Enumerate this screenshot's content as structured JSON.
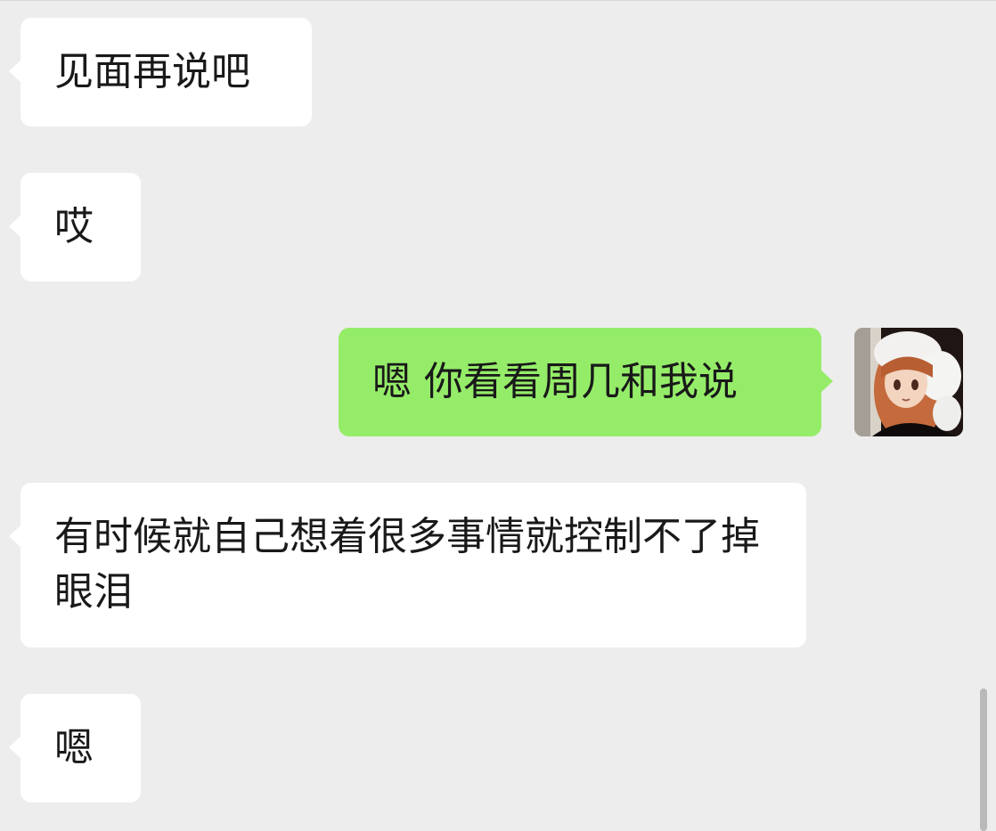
{
  "chat": {
    "messages": [
      {
        "side": "left",
        "text": "见面再说吧"
      },
      {
        "side": "left",
        "text": "哎"
      },
      {
        "side": "right",
        "text": "嗯 你看看周几和我说"
      },
      {
        "side": "left",
        "text": "有时候就自己想着很多事情就控制不了掉眼泪"
      },
      {
        "side": "left",
        "text": "嗯"
      }
    ]
  },
  "colors": {
    "background": "#ededed",
    "incoming_bubble": "#ffffff",
    "outgoing_bubble": "#95ec69",
    "text": "#191919"
  }
}
